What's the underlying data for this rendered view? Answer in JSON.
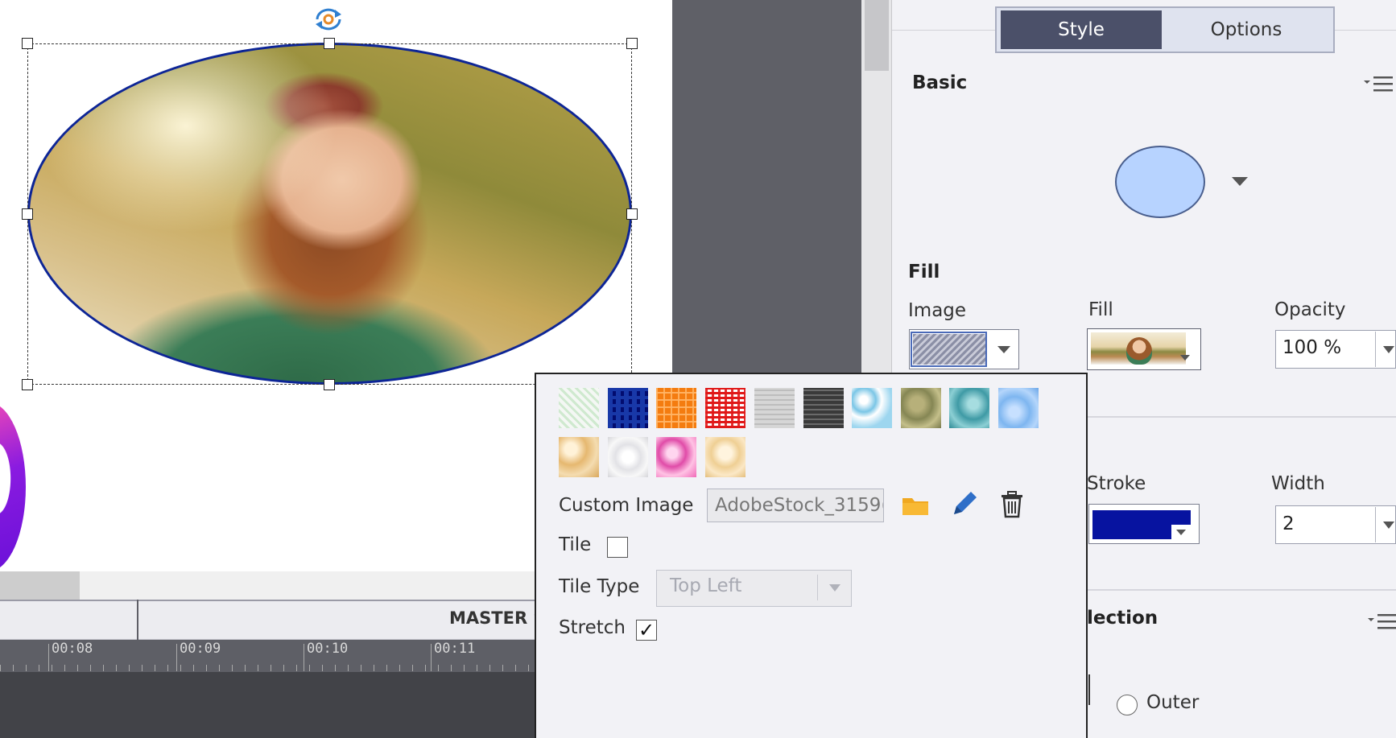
{
  "tabs": {
    "style": "Style",
    "options": "Options"
  },
  "sections": {
    "basic": "Basic",
    "fill": "Fill",
    "reflection": "lection"
  },
  "fill_fields": {
    "image_label": "Image",
    "fill_label": "Fill",
    "opacity_label": "Opacity",
    "opacity_value": "100 %"
  },
  "stroke_fields": {
    "stroke_label": "Stroke",
    "width_label": "Width",
    "width_value": "2"
  },
  "reflection": {
    "outer_label": "Outer"
  },
  "popup": {
    "custom_image_label": "Custom Image",
    "custom_image_value": "AdobeStock_3159(",
    "tile_label": "Tile",
    "tile_checked": false,
    "tile_type_label": "Tile Type",
    "tile_type_value": "Top Left",
    "stretch_label": "Stretch",
    "stretch_check": "✓"
  },
  "timeline": {
    "master_label": "MASTER S",
    "ticks": [
      "00:08",
      "00:09",
      "00:10",
      "00:11"
    ]
  },
  "colors": {
    "stroke_color": "#0713a0",
    "basic_shape_fill": "#b7d3ff",
    "active_tab": "#4b5069"
  },
  "icons": {
    "folder": "folder-icon",
    "pencil": "pencil-icon",
    "trash": "trash-icon",
    "rotate": "rotate-icon"
  }
}
